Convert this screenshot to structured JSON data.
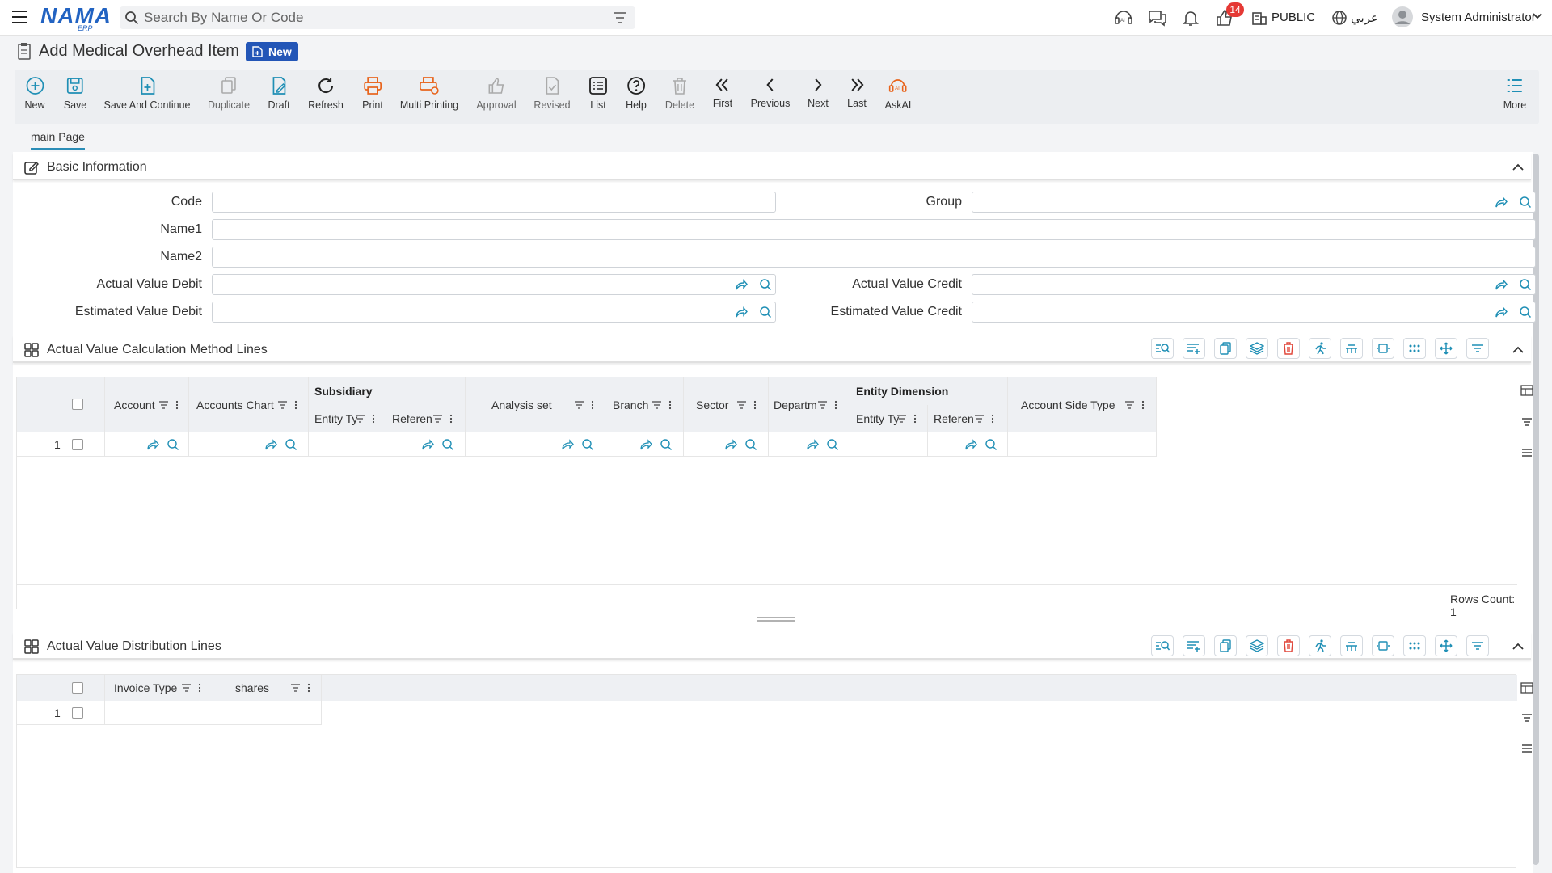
{
  "header": {
    "logo_main": "NAMA",
    "logo_sub": "ERP",
    "search_placeholder": "Search By Name Or Code",
    "notif_count": "14",
    "branch": "PUBLIC",
    "language": "عربي",
    "user": "System Administrator"
  },
  "page": {
    "title": "Add Medical Overhead Item",
    "badge": "New"
  },
  "toolbar": {
    "new": "New",
    "save": "Save",
    "save_continue": "Save And Continue",
    "duplicate": "Duplicate",
    "draft": "Draft",
    "refresh": "Refresh",
    "print": "Print",
    "multi_printing": "Multi Printing",
    "approval": "Approval",
    "revised": "Revised",
    "list": "List",
    "help": "Help",
    "delete": "Delete",
    "first": "First",
    "previous": "Previous",
    "next": "Next",
    "last": "Last",
    "askai": "AskAI",
    "more": "More"
  },
  "tabs": {
    "main": "main Page"
  },
  "basic": {
    "title": "Basic Information",
    "code": "Code",
    "group": "Group",
    "name1": "Name1",
    "name2": "Name2",
    "actual_debit": "Actual Value Debit",
    "actual_credit": "Actual Value Credit",
    "estimated_debit": "Estimated Value Debit",
    "estimated_credit": "Estimated Value Credit"
  },
  "calc_lines": {
    "title": "Actual Value Calculation Method Lines",
    "columns": {
      "account": "Account",
      "accounts_chart": "Accounts Chart",
      "subsidiary": "Subsidiary",
      "entity_type": "Entity Ty",
      "reference": "Referen",
      "analysis_set": "Analysis set",
      "branch": "Branch",
      "sector": "Sector",
      "department": "Departm",
      "entity_dimension": "Entity Dimension",
      "ed_entity_type": "Entity Ty",
      "ed_reference": "Referen",
      "account_side_type": "Account Side Type"
    },
    "row_number": "1",
    "rows_count": "Rows Count: 1"
  },
  "dist_lines": {
    "title": "Actual Value Distribution Lines",
    "columns": {
      "invoice_type": "Invoice Type",
      "shares": "shares"
    },
    "row_number": "1"
  },
  "colors": {
    "accent": "#1f8fb5",
    "badge": "#2356b7",
    "print": "#e8641c",
    "danger": "#e0463a"
  }
}
